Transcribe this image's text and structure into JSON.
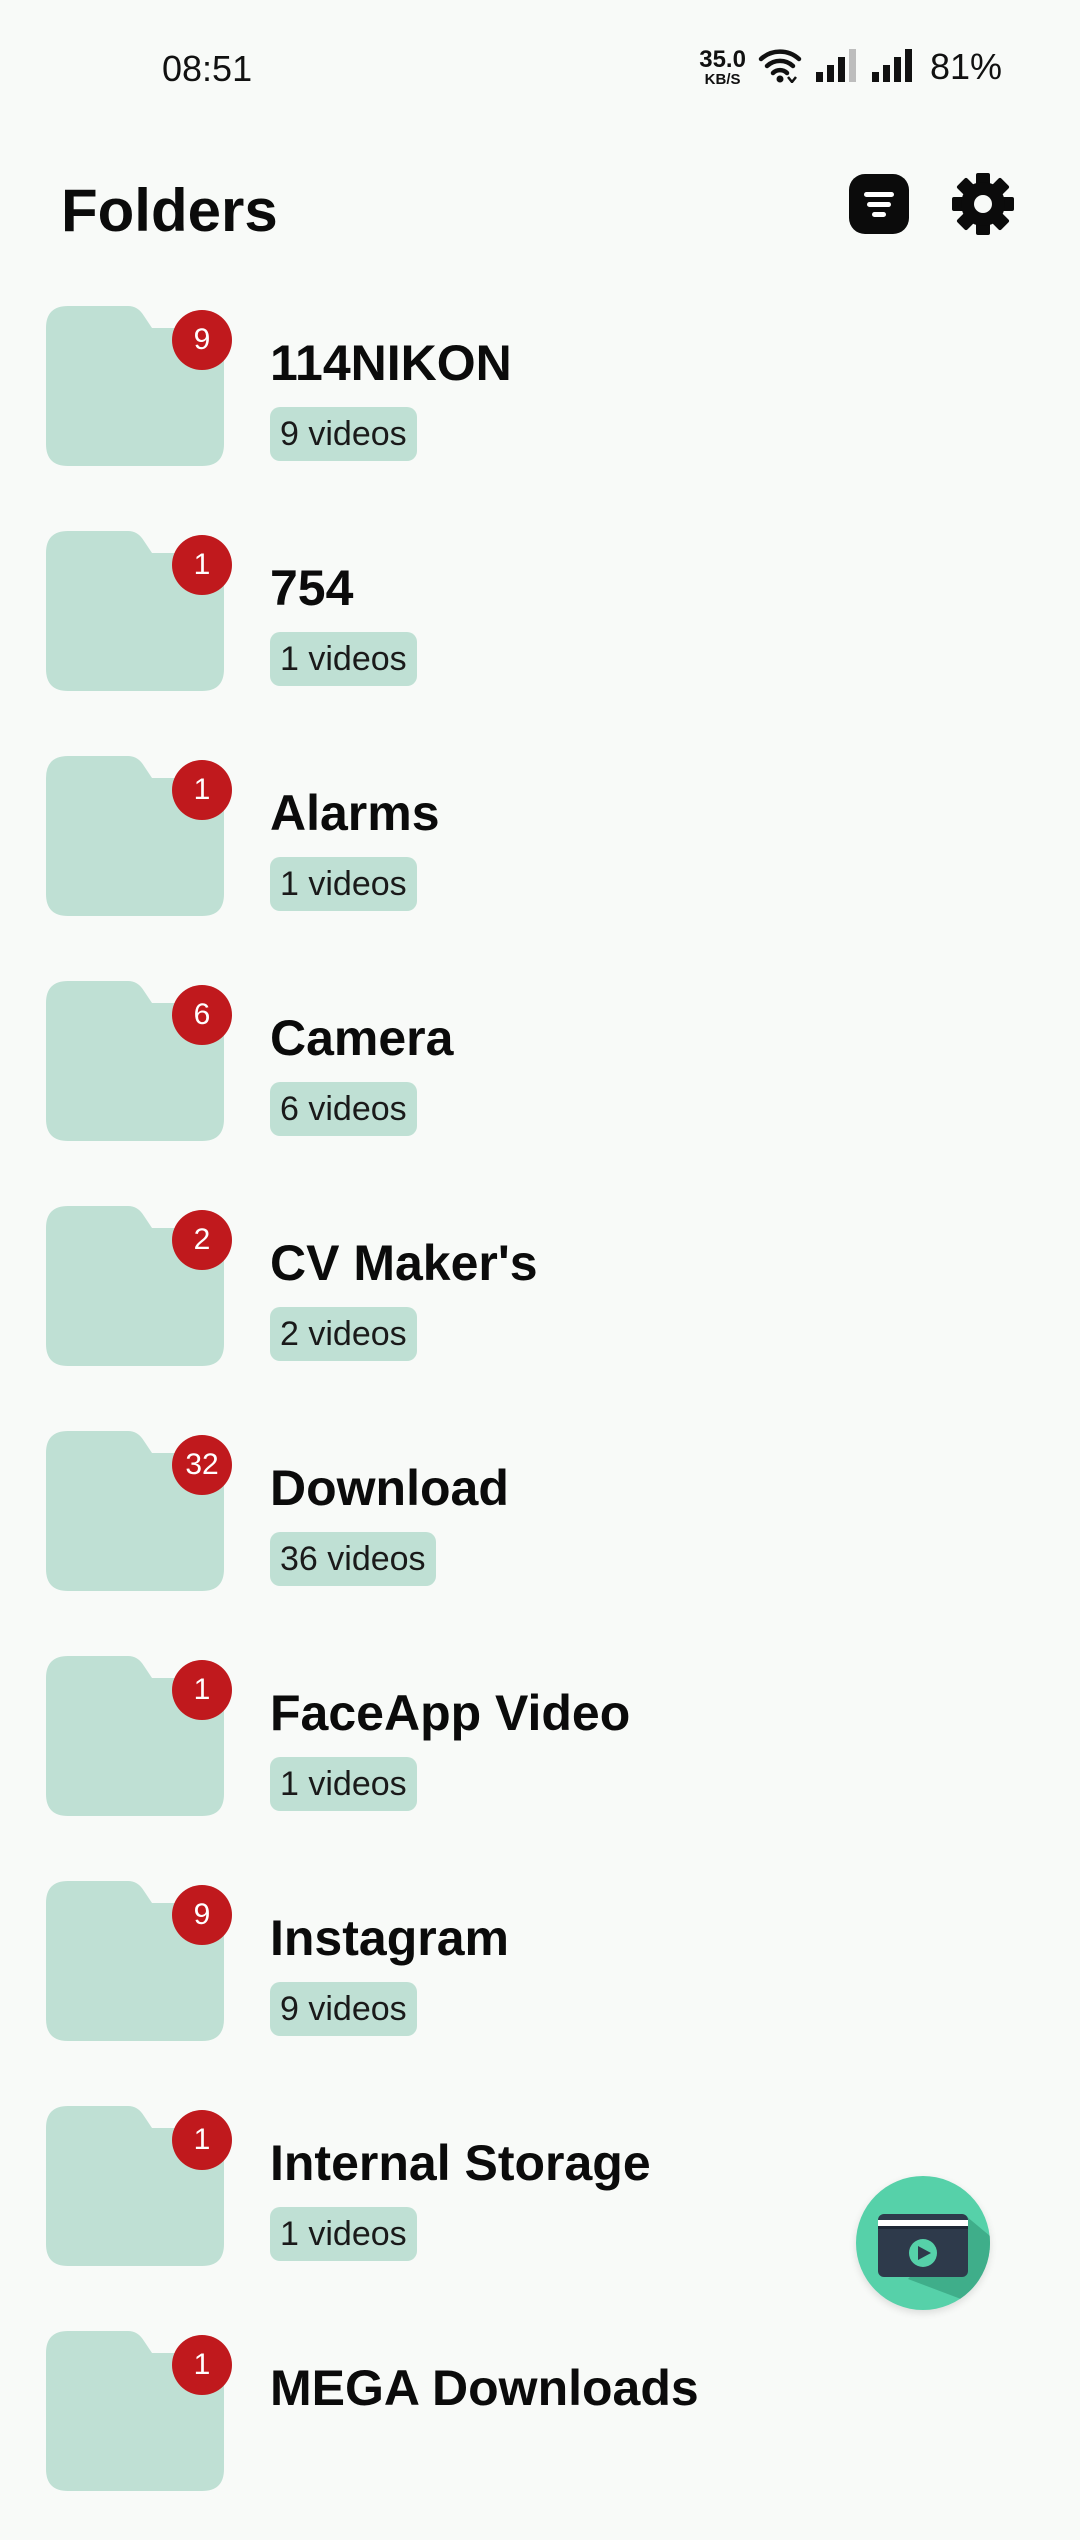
{
  "status_bar": {
    "time": "08:51",
    "net_speed_value": "35.0",
    "net_speed_unit": "KB/S",
    "battery": "81%"
  },
  "header": {
    "title": "Folders",
    "sort_icon": "sort-list-icon",
    "settings_icon": "gear-icon"
  },
  "folders": [
    {
      "name": "114NIKON",
      "badge": "9",
      "count": "9 videos"
    },
    {
      "name": "754",
      "badge": "1",
      "count": "1 videos"
    },
    {
      "name": "Alarms",
      "badge": "1",
      "count": "1 videos"
    },
    {
      "name": "Camera",
      "badge": "6",
      "count": "6 videos"
    },
    {
      "name": "CV Maker's",
      "badge": "2",
      "count": "2 videos"
    },
    {
      "name": "Download",
      "badge": "32",
      "count": "36 videos"
    },
    {
      "name": "FaceApp Video",
      "badge": "1",
      "count": "1 videos"
    },
    {
      "name": "Instagram",
      "badge": "9",
      "count": "9 videos"
    },
    {
      "name": "Internal Storage",
      "badge": "1",
      "count": "1 videos"
    },
    {
      "name": "MEGA Downloads",
      "badge": "1",
      "count": ""
    }
  ],
  "fab": {
    "icon": "video-player-icon"
  },
  "colors": {
    "folder": "#bfe0d4",
    "badge": "#c0191d",
    "fab": "#56d1a9",
    "background": "#f8faf8"
  }
}
